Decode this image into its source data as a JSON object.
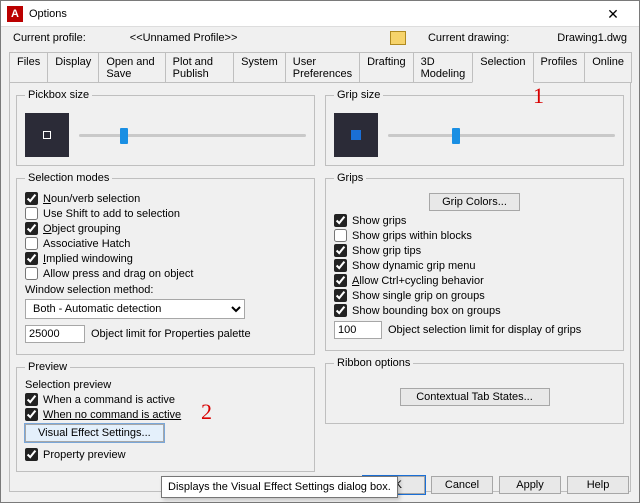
{
  "window": {
    "title": "Options"
  },
  "profile": {
    "label": "Current profile:",
    "value": "<<Unnamed Profile>>",
    "drawing_label": "Current drawing:",
    "drawing_value": "Drawing1.dwg"
  },
  "tabs": [
    "Files",
    "Display",
    "Open and Save",
    "Plot and Publish",
    "System",
    "User Preferences",
    "Drafting",
    "3D Modeling",
    "Selection",
    "Profiles",
    "Online"
  ],
  "active_tab": "Selection",
  "left": {
    "pickbox": {
      "legend": "Pickbox size"
    },
    "selmodes": {
      "legend": "Selection modes",
      "noun_verb": "Noun/verb selection",
      "use_shift": "Use Shift to add to selection",
      "obj_group": "Object grouping",
      "assoc_hatch": "Associative Hatch",
      "implied": "Implied windowing",
      "allow_press": "Allow press and drag on object",
      "win_method_label": "Window selection method:",
      "win_method_value": "Both - Automatic detection",
      "obj_limit_value": "25000",
      "obj_limit_label": "Object limit for Properties palette"
    },
    "preview": {
      "legend": "Preview",
      "sel_preview": "Selection preview",
      "when_cmd": "When a command is active",
      "when_no_cmd": "When no command is active",
      "vfx_btn": "Visual Effect Settings...",
      "prop_preview": "Property preview"
    }
  },
  "right": {
    "gripsize": {
      "legend": "Grip size"
    },
    "grips": {
      "legend": "Grips",
      "colors_btn": "Grip Colors...",
      "show_grips": "Show grips",
      "within_blocks": "Show grips within blocks",
      "grip_tips": "Show grip tips",
      "dyn_menu": "Show dynamic grip menu",
      "ctrl_cycle": "Allow Ctrl+cycling behavior",
      "single_group": "Show single grip on groups",
      "bbox_groups": "Show bounding box on groups",
      "obj_limit_value": "100",
      "obj_limit_label": "Object selection limit for display of grips"
    },
    "ribbon": {
      "legend": "Ribbon options",
      "ctx_btn": "Contextual Tab States..."
    }
  },
  "buttons": {
    "ok": "OK",
    "cancel": "Cancel",
    "apply": "Apply",
    "help": "Help"
  },
  "tooltip": "Displays the Visual Effect Settings dialog box.",
  "annotation": {
    "one": "1",
    "two": "2"
  }
}
